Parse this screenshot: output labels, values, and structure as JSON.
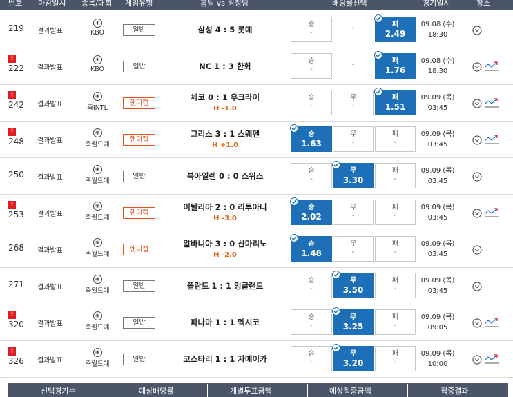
{
  "header": {
    "cols": [
      "번호",
      "마감일시",
      "종목/대회",
      "게임유형",
      "홈팀 vs 원정팀",
      "배당률선택",
      "경기일시",
      "장소"
    ]
  },
  "rows": [
    {
      "no": "219",
      "warn": false,
      "deadline": "결과발표",
      "league": "KBO",
      "sport_icon": "baseball-icon",
      "gtype": "일반",
      "match": "삼성 4 : 5 롯데",
      "handicap": "",
      "odds": [
        {
          "label": "승",
          "value": "-",
          "selected": false
        },
        {
          "label": "-",
          "value": "",
          "selected": false,
          "plain": true
        },
        {
          "label": "패",
          "value": "2.49",
          "selected": true
        }
      ],
      "date": "09.08 (수)",
      "time": "18:30",
      "trend": false
    },
    {
      "no": "222",
      "warn": true,
      "deadline": "결과발표",
      "league": "KBO",
      "sport_icon": "baseball-icon",
      "gtype": "일반",
      "match": "NC 1 : 3 한화",
      "handicap": "",
      "odds": [
        {
          "label": "승",
          "value": "-",
          "selected": false
        },
        {
          "label": "-",
          "value": "",
          "selected": false,
          "plain": true
        },
        {
          "label": "패",
          "value": "1.76",
          "selected": true
        }
      ],
      "date": "09.08 (수)",
      "time": "18:30",
      "trend": true
    },
    {
      "no": "242",
      "warn": true,
      "deadline": "결과발표",
      "league": "축INTL",
      "sport_icon": "soccer-ball-icon",
      "gtype": "핸디캡",
      "match": "체코 0 : 1 우크라이",
      "handicap": "H -1.0",
      "odds": [
        {
          "label": "승",
          "value": "-",
          "selected": false
        },
        {
          "label": "무",
          "value": "-",
          "selected": false
        },
        {
          "label": "패",
          "value": "1.51",
          "selected": true
        }
      ],
      "date": "09.09 (목)",
      "time": "03:45",
      "trend": true
    },
    {
      "no": "248",
      "warn": true,
      "deadline": "결과발표",
      "league": "축월드예",
      "sport_icon": "soccer-ball-icon",
      "gtype": "핸디캡",
      "match": "그리스 3 : 1 스웨덴",
      "handicap": "H +1.0",
      "odds": [
        {
          "label": "승",
          "value": "1.63",
          "selected": true
        },
        {
          "label": "무",
          "value": "-",
          "selected": false
        },
        {
          "label": "패",
          "value": "-",
          "selected": false
        }
      ],
      "date": "09.09 (목)",
      "time": "03:45",
      "trend": true
    },
    {
      "no": "250",
      "warn": false,
      "deadline": "결과발표",
      "league": "축월드예",
      "sport_icon": "soccer-ball-icon",
      "gtype": "일반",
      "match": "북아일랜 0 : 0 스위스",
      "handicap": "",
      "odds": [
        {
          "label": "승",
          "value": "-",
          "selected": false
        },
        {
          "label": "무",
          "value": "3.30",
          "selected": true
        },
        {
          "label": "패",
          "value": "-",
          "selected": false
        }
      ],
      "date": "09.09 (목)",
      "time": "03:45",
      "trend": false
    },
    {
      "no": "253",
      "warn": true,
      "deadline": "결과발표",
      "league": "축월드예",
      "sport_icon": "soccer-ball-icon",
      "gtype": "핸디캡",
      "match": "이탈리아 2 : 0 리투아니",
      "handicap": "H -3.0",
      "odds": [
        {
          "label": "승",
          "value": "2.02",
          "selected": true
        },
        {
          "label": "무",
          "value": "-",
          "selected": false
        },
        {
          "label": "패",
          "value": "-",
          "selected": false
        }
      ],
      "date": "09.09 (목)",
      "time": "03:45",
      "trend": true
    },
    {
      "no": "268",
      "warn": false,
      "deadline": "결과발표",
      "league": "축월드예",
      "sport_icon": "soccer-ball-icon",
      "gtype": "핸디캡",
      "match": "알바니아 3 : 0 산마리노",
      "handicap": "H -2.0",
      "odds": [
        {
          "label": "승",
          "value": "1.48",
          "selected": true
        },
        {
          "label": "무",
          "value": "-",
          "selected": false
        },
        {
          "label": "패",
          "value": "-",
          "selected": false
        }
      ],
      "date": "09.09 (목)",
      "time": "03:45",
      "trend": false
    },
    {
      "no": "271",
      "warn": false,
      "deadline": "결과발표",
      "league": "축월드예",
      "sport_icon": "soccer-ball-icon",
      "gtype": "일반",
      "match": "폴란드 1 : 1 잉글랜드",
      "handicap": "",
      "odds": [
        {
          "label": "승",
          "value": "-",
          "selected": false
        },
        {
          "label": "무",
          "value": "3.50",
          "selected": true
        },
        {
          "label": "패",
          "value": "-",
          "selected": false
        }
      ],
      "date": "09.09 (목)",
      "time": "03:45",
      "trend": false
    },
    {
      "no": "320",
      "warn": true,
      "deadline": "결과발표",
      "league": "축월드예",
      "sport_icon": "soccer-ball-icon",
      "gtype": "일반",
      "match": "파나마 1 : 1 멕시코",
      "handicap": "",
      "odds": [
        {
          "label": "승",
          "value": "-",
          "selected": false
        },
        {
          "label": "무",
          "value": "3.25",
          "selected": true
        },
        {
          "label": "패",
          "value": "-",
          "selected": false
        }
      ],
      "date": "09.09 (목)",
      "time": "09:05",
      "trend": true
    },
    {
      "no": "326",
      "warn": true,
      "deadline": "결과발표",
      "league": "축월드예",
      "sport_icon": "soccer-ball-icon",
      "gtype": "일반",
      "match": "코스타리 1 : 1 자메이카",
      "handicap": "",
      "odds": [
        {
          "label": "승",
          "value": "-",
          "selected": false
        },
        {
          "label": "무",
          "value": "3.20",
          "selected": true
        },
        {
          "label": "패",
          "value": "-",
          "selected": false
        }
      ],
      "date": "09.09 (목)",
      "time": "10:00",
      "trend": true
    }
  ],
  "footer": {
    "cols": [
      "선택경기수",
      "예상배당률",
      "개별투표금액",
      "예상적중금액",
      "적중결과"
    ]
  },
  "colors": {
    "header_bg": "#4a5668",
    "selected": "#1d6fb8",
    "warn": "#e01c24",
    "handicap": "#e0531c"
  }
}
